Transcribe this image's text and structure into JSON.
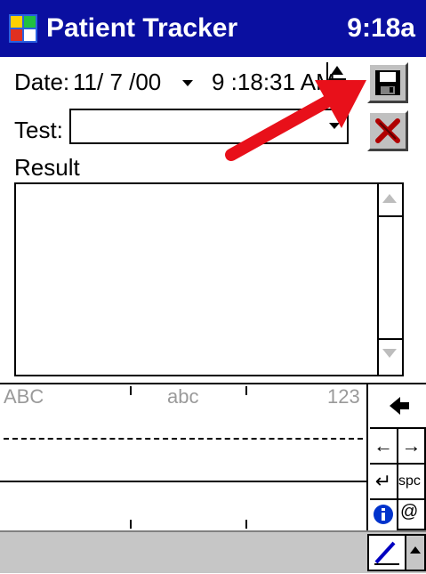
{
  "titlebar": {
    "app_title": "Patient Tracker",
    "clock": "9:18a",
    "icon": "app-logo-icon"
  },
  "form": {
    "date_label": "Date:",
    "date_value": "11/ 7 /00",
    "time_value": "9 :18:31 AM",
    "test_label": "Test:",
    "test_value": "",
    "result_label": "Result",
    "result_value": ""
  },
  "buttons": {
    "save": "floppy-disk-icon",
    "delete": "red-x-icon"
  },
  "input_panel": {
    "zone_upper": "ABC",
    "zone_lower": "abc",
    "zone_digits": "123",
    "key_left": "←",
    "key_right": "→",
    "key_enter": "↵",
    "key_space": "spc",
    "key_symbols": "@"
  },
  "colors": {
    "titlebar": "#0a0fa0",
    "arrow": "#e8101a",
    "delete_x": "#b00000"
  }
}
